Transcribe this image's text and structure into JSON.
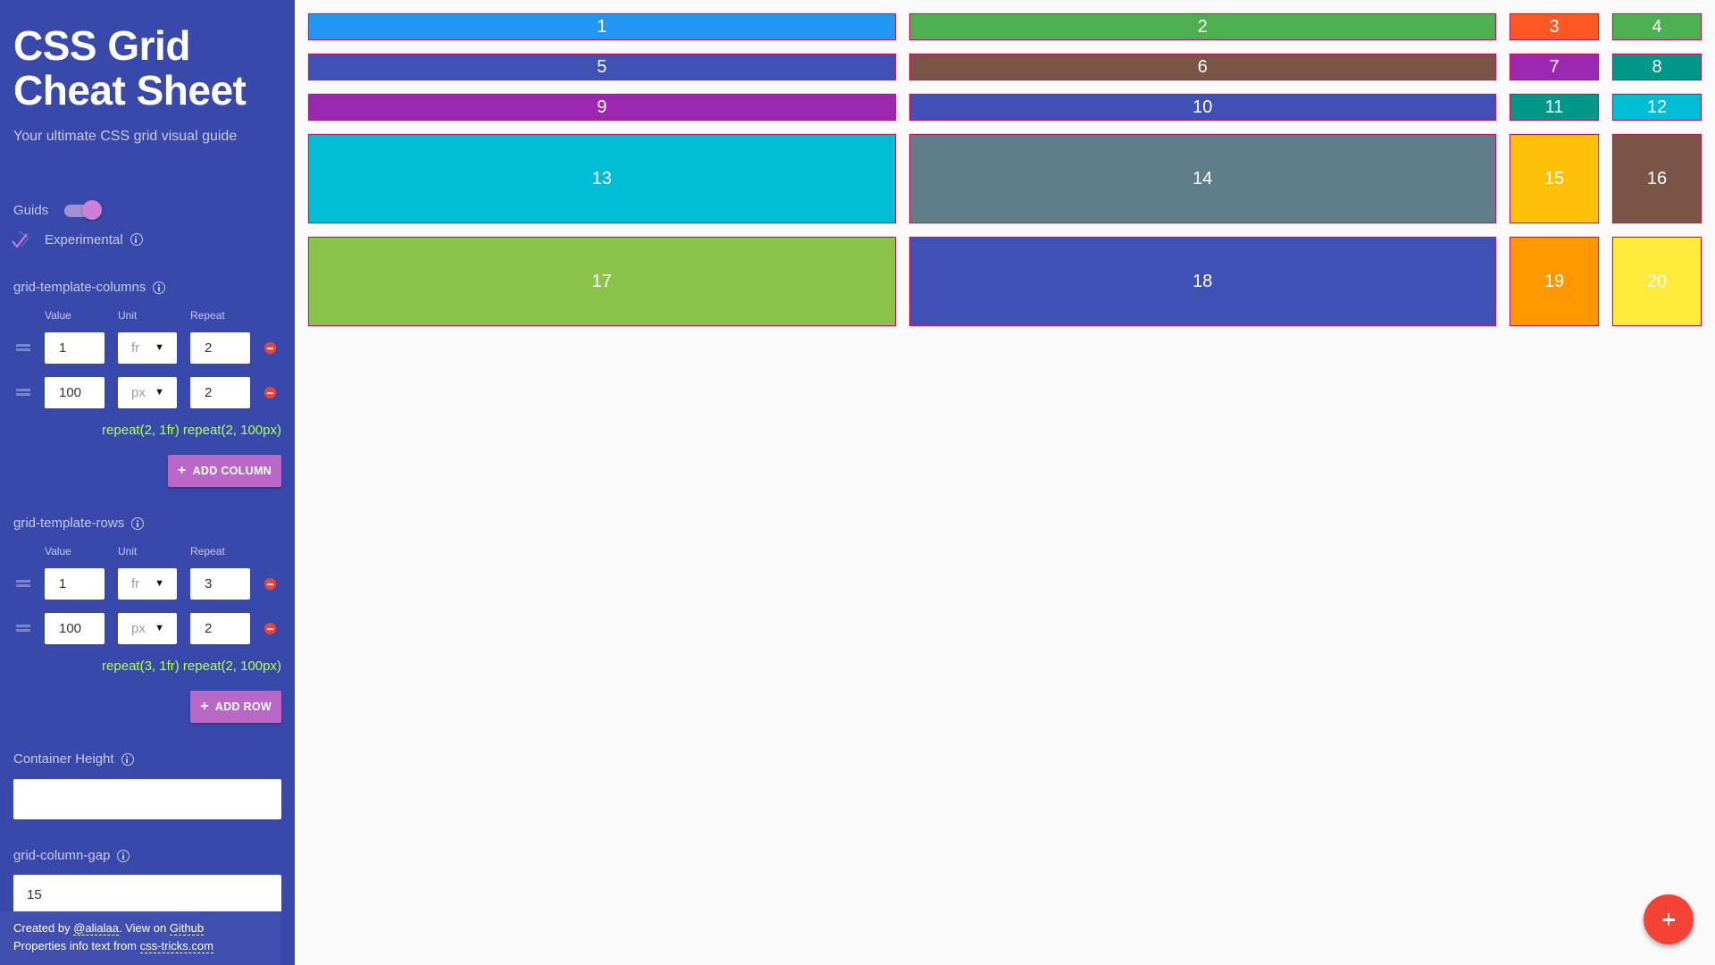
{
  "sidebar": {
    "title_line1": "CSS Grid",
    "title_line2": "Cheat Sheet",
    "subtitle": "Your ultimate CSS grid visual guide",
    "guides": {
      "label": "Guids",
      "enabled": true
    },
    "experimental": {
      "label": "Experimental",
      "checked": true,
      "info_icon": "info-icon"
    },
    "columns_section": {
      "label": "grid-template-columns",
      "headers": [
        "Value",
        "Unit",
        "Repeat"
      ],
      "tracks": [
        {
          "value": "1",
          "unit": "fr",
          "repeat": "2"
        },
        {
          "value": "100",
          "unit": "px",
          "repeat": "2"
        }
      ],
      "output": "repeat(2, 1fr) repeat(2, 100px)",
      "add_label": "ADD COLUMN"
    },
    "rows_section": {
      "label": "grid-template-rows",
      "headers": [
        "Value",
        "Unit",
        "Repeat"
      ],
      "tracks": [
        {
          "value": "1",
          "unit": "fr",
          "repeat": "3"
        },
        {
          "value": "100",
          "unit": "px",
          "repeat": "2"
        }
      ],
      "output": "repeat(3, 1fr) repeat(2, 100px)",
      "add_label": "ADD ROW"
    },
    "container_height": {
      "label": "Container Height",
      "value": ""
    },
    "column_gap": {
      "label": "grid-column-gap",
      "value": "15"
    },
    "footer": {
      "created_by": "Created by ",
      "author_link": "@alialaa",
      "view_on": ". View on ",
      "github_link": "Github",
      "properties_info": "Properties info text from ",
      "css_tricks_link": "css-tricks.com"
    }
  },
  "grid": {
    "cells": [
      {
        "label": "1",
        "color": "#2196f3"
      },
      {
        "label": "2",
        "color": "#4caf50"
      },
      {
        "label": "3",
        "color": "#ff5722"
      },
      {
        "label": "4",
        "color": "#4caf50"
      },
      {
        "label": "5",
        "color": "#3f51b5"
      },
      {
        "label": "6",
        "color": "#795548"
      },
      {
        "label": "7",
        "color": "#9c27b0"
      },
      {
        "label": "8",
        "color": "#009688"
      },
      {
        "label": "9",
        "color": "#9c27b0"
      },
      {
        "label": "10",
        "color": "#3f51b5"
      },
      {
        "label": "11",
        "color": "#009688"
      },
      {
        "label": "12",
        "color": "#00bcd4"
      },
      {
        "label": "13",
        "color": "#00bcd4"
      },
      {
        "label": "14",
        "color": "#607d8b"
      },
      {
        "label": "15",
        "color": "#ffc107"
      },
      {
        "label": "16",
        "color": "#795548"
      },
      {
        "label": "17",
        "color": "#8bc34a"
      },
      {
        "label": "18",
        "color": "#3f51b5"
      },
      {
        "label": "19",
        "color": "#ff9800"
      },
      {
        "label": "20",
        "color": "#ffeb3b"
      }
    ]
  },
  "fab": {
    "icon": "plus-icon"
  },
  "colors": {
    "sidebar_bg": "#3949ab",
    "accent": "#ba68c8",
    "output_text": "#b2ff59",
    "danger": "#f44336"
  }
}
